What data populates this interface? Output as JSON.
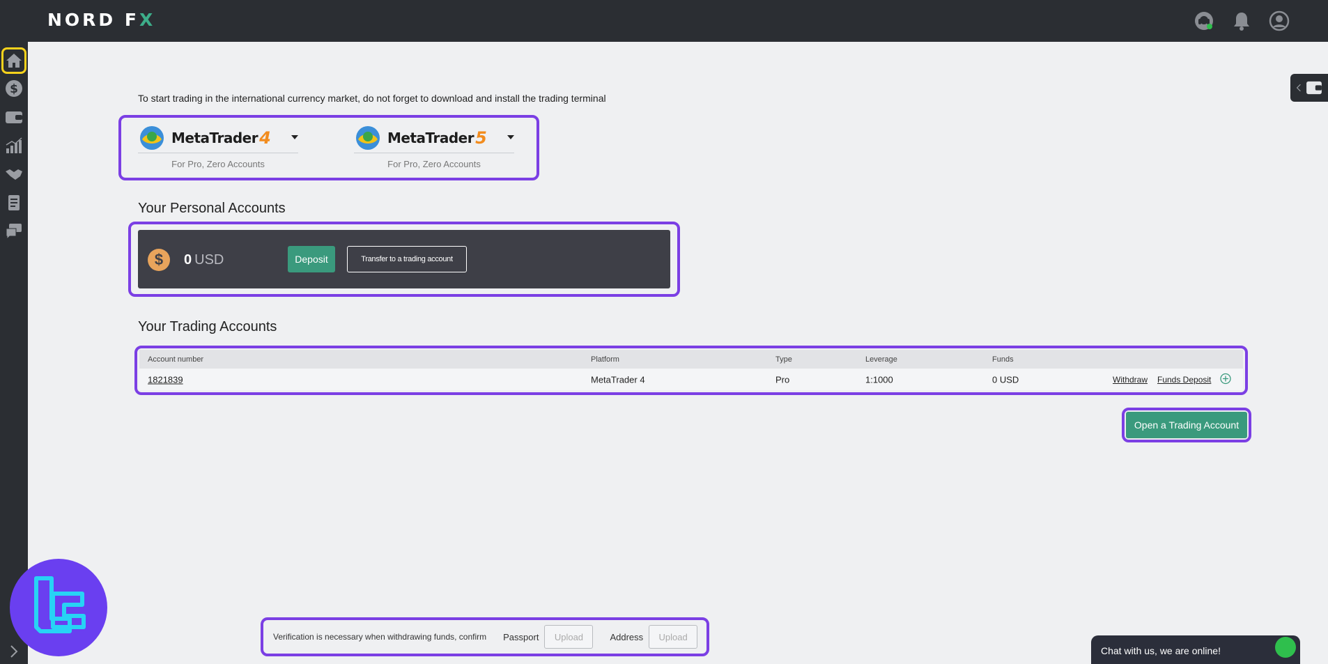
{
  "brand": {
    "logo_text": "NORD F",
    "logo_x": "X"
  },
  "intro": "To start trading in the international currency market, do not forget to download and install the trading terminal",
  "terminals": [
    {
      "name": "MetaTrader",
      "version": "4",
      "subtitle": "For Pro, Zero Accounts"
    },
    {
      "name": "MetaTrader",
      "version": "5",
      "subtitle": "For Pro, Zero Accounts"
    }
  ],
  "personal": {
    "title": "Your Personal Accounts",
    "amount": "0",
    "currency": "USD",
    "deposit_label": "Deposit",
    "transfer_label": "Transfer to a trading account"
  },
  "trading": {
    "title": "Your Trading Accounts",
    "headers": [
      "Account number",
      "Platform",
      "Type",
      "Leverage",
      "Funds"
    ],
    "rows": [
      {
        "account": "1821839",
        "platform": "MetaTrader 4",
        "type": "Pro",
        "leverage": "1:1000",
        "funds": "0 USD",
        "withdraw": "Withdraw",
        "funds_deposit": "Funds Deposit"
      }
    ],
    "open_label": "Open a Trading Account"
  },
  "verification": {
    "text": "Verification is necessary when withdrawing funds, confirm",
    "passport_label": "Passport",
    "address_label": "Address",
    "upload_label": "Upload"
  },
  "chat": {
    "text": "Chat with us, we are online!"
  },
  "colors": {
    "accent": "#3a9a7d",
    "highlight": "#7b3fe4",
    "active": "#f7d21c",
    "dark": "#2b2e33"
  },
  "icons": {
    "sidebar": [
      "home-icon",
      "dollar-icon",
      "wallet-icon",
      "chart-icon",
      "handshake-icon",
      "document-icon",
      "chat-icon"
    ],
    "top": [
      "support-icon",
      "bell-icon",
      "user-icon"
    ]
  }
}
